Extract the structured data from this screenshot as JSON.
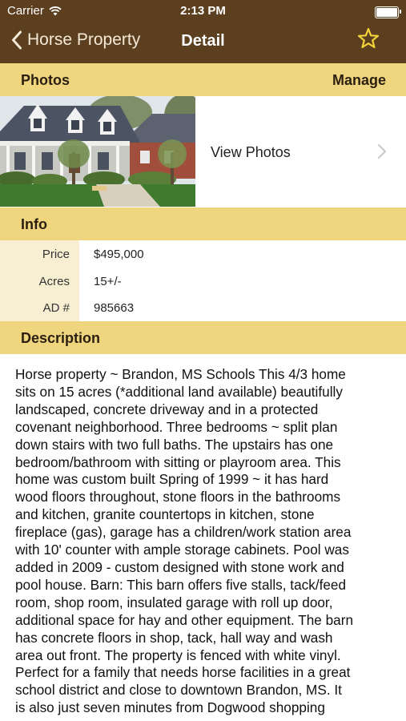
{
  "status_bar": {
    "carrier": "Carrier",
    "time": "2:13 PM",
    "battery_level": 1.0
  },
  "nav": {
    "back_label": "Horse Property",
    "title": "Detail",
    "favorite_icon": "star-outline-icon"
  },
  "photos_section": {
    "header": "Photos",
    "manage_label": "Manage",
    "view_photos_label": "View Photos"
  },
  "info_section": {
    "header": "Info",
    "rows": [
      {
        "key": "Price",
        "value": "$495,000"
      },
      {
        "key": "Acres",
        "value": "15+/-"
      },
      {
        "key": "AD #",
        "value": "985663"
      }
    ]
  },
  "description_section": {
    "header": "Description",
    "text": "Horse property ~ Brandon, MS Schools This 4/3 home\nsits on 15 acres (*additional land available) beautifully\nlandscaped, concrete driveway and in a protected\ncovenant neighborhood. Three bedrooms ~ split plan\ndown stairs with two full baths. The upstairs has one\nbedroom/bathroom with sitting or playroom area. This\nhome was custom built Spring of 1999 ~ it has hard\nwood floors throughout, stone floors in the bathrooms\nand kitchen, granite countertops in kitchen, stone\nfireplace (gas), garage has a children/work station area\nwith 10' counter with ample storage cabinets. Pool was\nadded in 2009 - custom designed with stone work and\npool house. Barn: This barn offers five stalls, tack/feed\nroom, shop room, insulated garage with roll up door,\nadditional space for hay and other equipment. The barn\nhas concrete floors in shop, tack, hall way and wash\narea out front. The property is fenced with white vinyl.\nPerfect for a family that needs horse facilities in a great\nschool district and close to downtown Brandon, MS. It\nis also just seven minutes from Dogwood shopping"
  },
  "colors": {
    "nav_background": "#5c3f1f",
    "section_header_background": "#f0d57f",
    "info_key_background": "#f8efd2",
    "star_accent": "#f3d23a"
  }
}
